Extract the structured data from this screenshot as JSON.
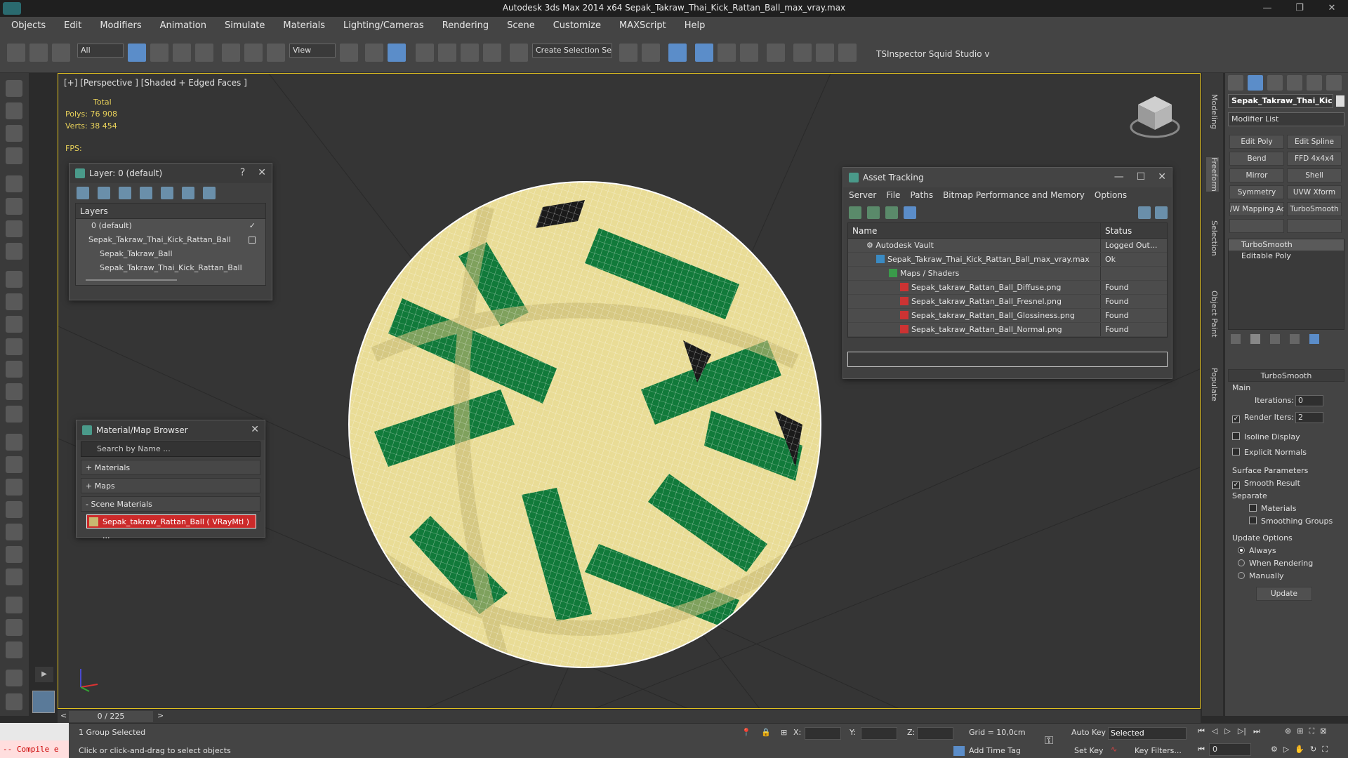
{
  "window": {
    "title": "Autodesk 3ds Max  2014 x64     Sepak_Takraw_Thai_Kick_Rattan_Ball_max_vray.max",
    "controls": [
      "—",
      "❐",
      "✕"
    ]
  },
  "menu": [
    "Objects",
    "Edit",
    "Modifiers",
    "Animation",
    "Simulate",
    "Materials",
    "Lighting/Cameras",
    "Rendering",
    "Scene",
    "Customize",
    "MAXScript",
    "Help"
  ],
  "toolbar": {
    "filter_value": "All",
    "refcoord_value": "View",
    "selection_set_placeholder": "Create Selection Se",
    "right_text": "TSInspector  Squid Studio v"
  },
  "viewport": {
    "label": "[+] [Perspective ] [Shaded + Edged Faces ]",
    "stats_header": "Total",
    "polys_label": "Polys:",
    "polys_value": "76 908",
    "verts_label": "Verts:",
    "verts_value": "38 454",
    "fps_label": "FPS:"
  },
  "layer_window": {
    "title": "Layer: 0 (default)",
    "help": "?",
    "close": "✕",
    "header": "Layers",
    "rows": [
      {
        "label": "0 (default)",
        "indent": 1
      },
      {
        "label": "Sepak_Takraw_Thai_Kick_Rattan_Ball",
        "indent": 0
      },
      {
        "label": "Sepak_Takraw_Ball",
        "indent": 2
      },
      {
        "label": "Sepak_Takraw_Thai_Kick_Rattan_Ball",
        "indent": 2
      }
    ]
  },
  "asset_window": {
    "title": "Asset Tracking",
    "menu": [
      "Server",
      "File",
      "Paths",
      "Bitmap Performance and Memory",
      "Options"
    ],
    "col_name": "Name",
    "col_status": "Status",
    "rows": [
      {
        "name": "Autodesk Vault",
        "status": "Logged Out..."
      },
      {
        "name": "Sepak_Takraw_Thai_Kick_Rattan_Ball_max_vray.max",
        "status": "Ok"
      },
      {
        "name": "Maps / Shaders",
        "status": ""
      },
      {
        "name": "Sepak_takraw_Rattan_Ball_Diffuse.png",
        "status": "Found"
      },
      {
        "name": "Sepak_takraw_Rattan_Ball_Fresnel.png",
        "status": "Found"
      },
      {
        "name": "Sepak_takraw_Rattan_Ball_Glossiness.png",
        "status": "Found"
      },
      {
        "name": "Sepak_takraw_Rattan_Ball_Normal.png",
        "status": "Found"
      }
    ]
  },
  "material_browser": {
    "title": "Material/Map Browser",
    "close": "✕",
    "search_placeholder": "Search by Name ...",
    "sections": [
      "+ Materials",
      "+ Maps",
      "- Scene Materials"
    ],
    "scene_material": "Sepak_takraw_Rattan_Ball  ( VRayMtl ) ..."
  },
  "command_panel": {
    "object_name": "Sepak_Takraw_Thai_Kicl",
    "modifier_list": "Modifier List",
    "buttons": [
      "Edit Poly",
      "Edit Spline",
      "Bend",
      "FFD 4x4x4",
      "Mirror",
      "Shell",
      "Symmetry",
      "UVW Xform",
      "/W Mapping Ac",
      "TurboSmooth"
    ],
    "stack": [
      "TurboSmooth",
      "Editable Poly"
    ],
    "rollout_title": "TurboSmooth",
    "main_label": "Main",
    "iterations_label": "Iterations:",
    "iterations_value": "0",
    "render_iters_label": "Render Iters:",
    "render_iters_value": "2",
    "isoline": "Isoline Display",
    "explicit_normals": "Explicit Normals",
    "surface_params": "Surface Parameters",
    "smooth_result": "Smooth Result",
    "separate": "Separate",
    "materials": "Materials",
    "smoothing_groups": "Smoothing Groups",
    "update_options": "Update Options",
    "always": "Always",
    "when_rendering": "When Rendering",
    "manually": "Manually",
    "update_button": "Update"
  },
  "side_tabs": [
    "Modeling",
    "Freeform",
    "Selection",
    "Object Paint",
    "Populate"
  ],
  "timeline": {
    "frame": "0 / 225",
    "prev": "<",
    "next": ">"
  },
  "status": {
    "compile": "-- Compile e",
    "selection": "1 Group Selected",
    "prompt": "Click or click-and-drag to select objects",
    "x_label": "X:",
    "y_label": "Y:",
    "z_label": "Z:",
    "grid": "Grid = 10,0cm",
    "auto_key": "Auto Key",
    "set_key": "Set Key",
    "selected": "Selected",
    "key_filters": "Key Filters...",
    "add_time_tag": "Add Time Tag",
    "frame_field": "0"
  },
  "colors": {
    "rattan": "#e9dc96",
    "stripe": "#117a3a",
    "wire": "#ffffff",
    "viewport_border": "#e0c020",
    "accent": "#5b8dc9"
  }
}
